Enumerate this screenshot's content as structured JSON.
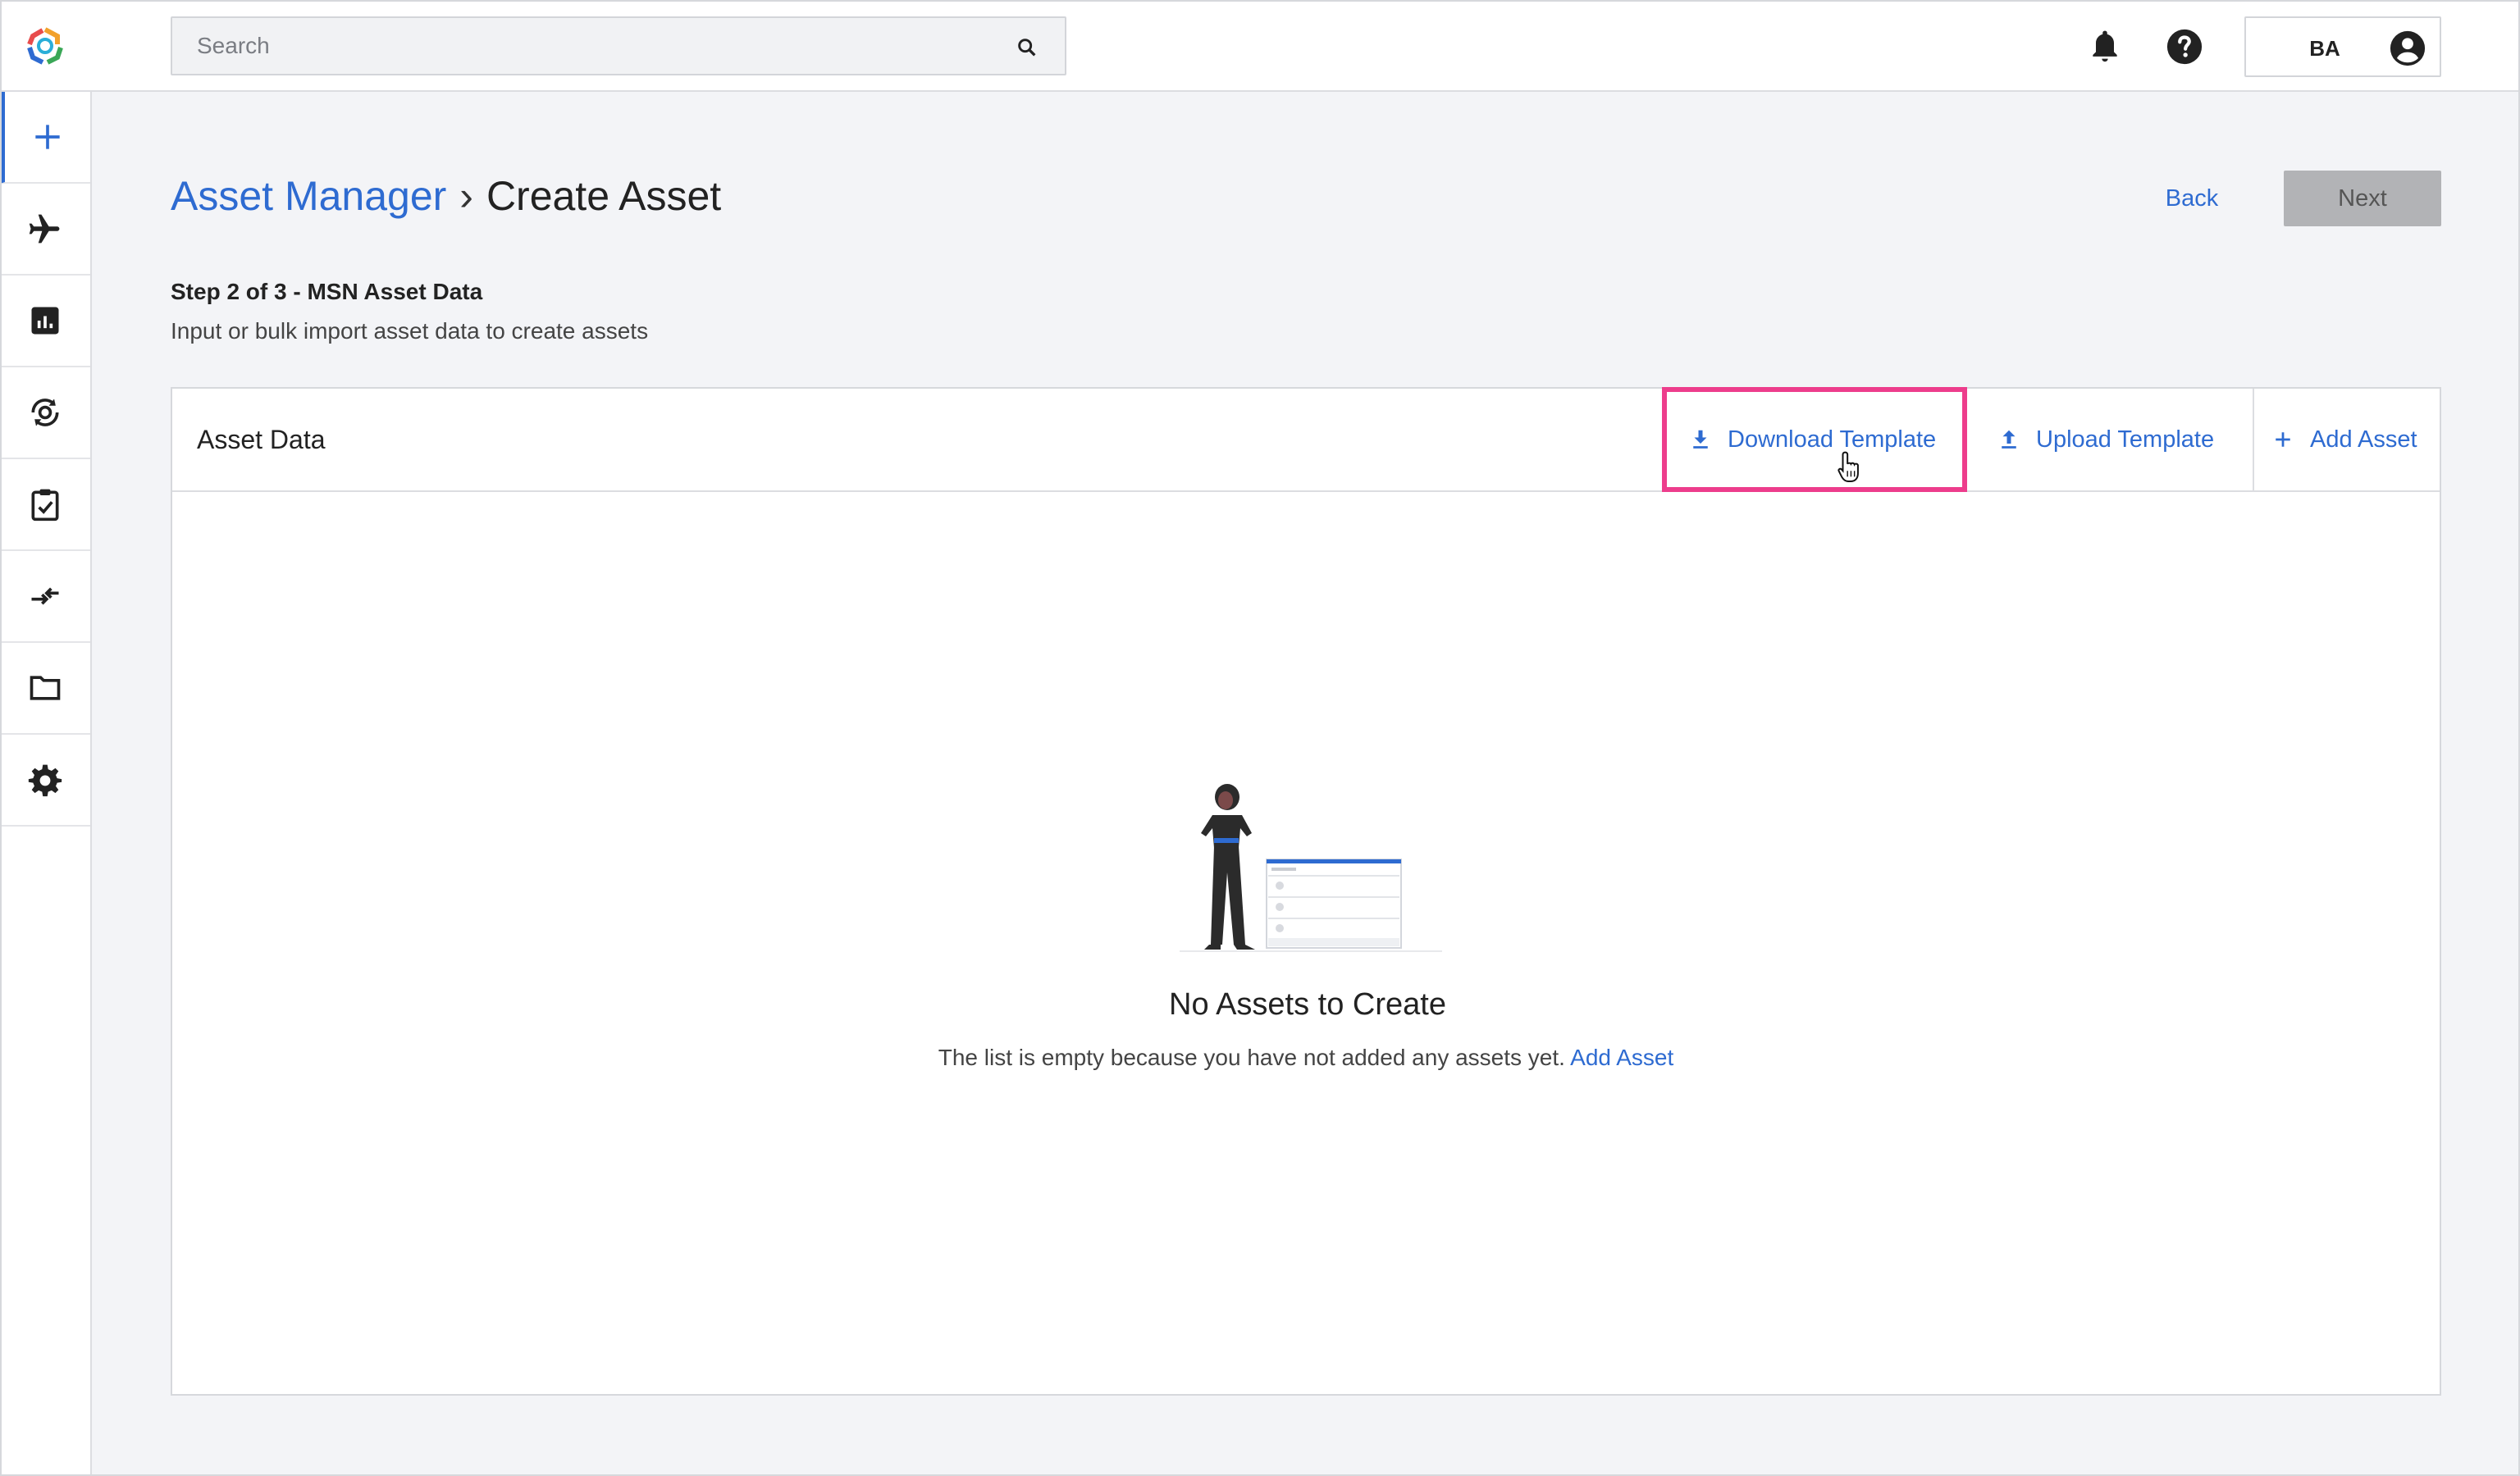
{
  "topbar": {
    "search_placeholder": "Search",
    "user_initials": "BA"
  },
  "sidebar": {
    "items": [
      {
        "name": "create",
        "icon": "plus-icon",
        "active": true
      },
      {
        "name": "aircraft",
        "icon": "airplane-icon"
      },
      {
        "name": "reports",
        "icon": "chart-icon"
      },
      {
        "name": "engines",
        "icon": "engine-cycle-icon"
      },
      {
        "name": "tasks",
        "icon": "clipboard-check-icon"
      },
      {
        "name": "transfers",
        "icon": "transfer-arrows-icon"
      },
      {
        "name": "documents",
        "icon": "folder-icon"
      },
      {
        "name": "settings",
        "icon": "gear-icon"
      }
    ]
  },
  "header": {
    "breadcrumb_parent": "Asset Manager",
    "breadcrumb_separator": "›",
    "breadcrumb_current": "Create Asset",
    "back_label": "Back",
    "next_label": "Next"
  },
  "step": {
    "title": "Step 2 of 3 - MSN Asset Data",
    "subtitle": "Input or bulk import asset data to create assets"
  },
  "card": {
    "title": "Asset Data",
    "download_label": "Download Template",
    "upload_label": "Upload Template",
    "add_label": "Add Asset",
    "empty_title": "No Assets to Create",
    "empty_text": "The list is empty because you have not added any assets yet.",
    "empty_link": "Add Asset"
  },
  "colors": {
    "accent": "#2e6bd1",
    "highlight": "#ed3d8c",
    "disabled_button": "#b2b3b6"
  }
}
